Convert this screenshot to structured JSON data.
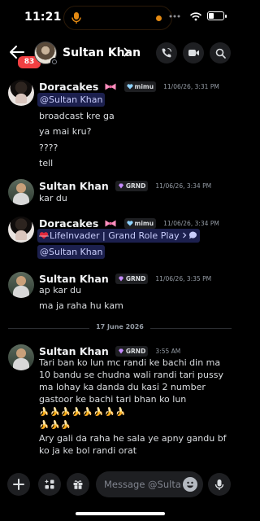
{
  "status_bar": {
    "time": "11:21"
  },
  "header": {
    "unread_badge": "83",
    "title": "Sultan Khan",
    "icons": [
      "back-arrow-icon",
      "phone-call-icon",
      "video-camera-icon",
      "search-icon"
    ]
  },
  "messages": [
    {
      "author": "Doracakes",
      "tag": "mimu",
      "timestamp": "11/06/26, 3:31 PM",
      "mention": "@Sultan Khan",
      "lines": [
        "broadcast kre ga",
        "ya mai kru?",
        "????",
        "tell"
      ]
    },
    {
      "author": "Sultan Khan",
      "tag": "GRND",
      "timestamp": "11/06/26, 3:34 PM",
      "lines": [
        "kar du"
      ]
    },
    {
      "author": "Doracakes",
      "tag": "mimu",
      "timestamp": "11/06/26, 3:34 PM",
      "channel_link": "LifeInvader | Grand Role Play",
      "mention": "@Sultan Khan"
    },
    {
      "author": "Sultan Khan",
      "tag": "GRND",
      "timestamp": "11/06/26, 3:35 PM",
      "lines": [
        "ap kar du",
        "ma ja raha hu kam"
      ]
    }
  ],
  "date_divider": "17 June 2026",
  "last_message": {
    "author": "Sultan Khan",
    "tag": "GRND",
    "timestamp": "3:55 AM",
    "text": "Tari ban ko lun mc randi ke bachi din ma 10 bandu se chudna wali randi tari pussy ma lohay ka danda du kasi 2 number gastoor ke bachi tari bhan ko lun",
    "emoji_run_1": "🍌🍌🍌🍌🍌🍌🍌🍌",
    "emoji_run_2": "🍌🍌🍌",
    "text_2": "Ary gali da raha he sala ye apny gandu bf ko ja ke bol randi orat"
  },
  "composer": {
    "placeholder": "Message @Sultan Khan"
  },
  "colors": {
    "accent": "#5865f2",
    "badge": "#f23f42",
    "background": "#000000"
  }
}
